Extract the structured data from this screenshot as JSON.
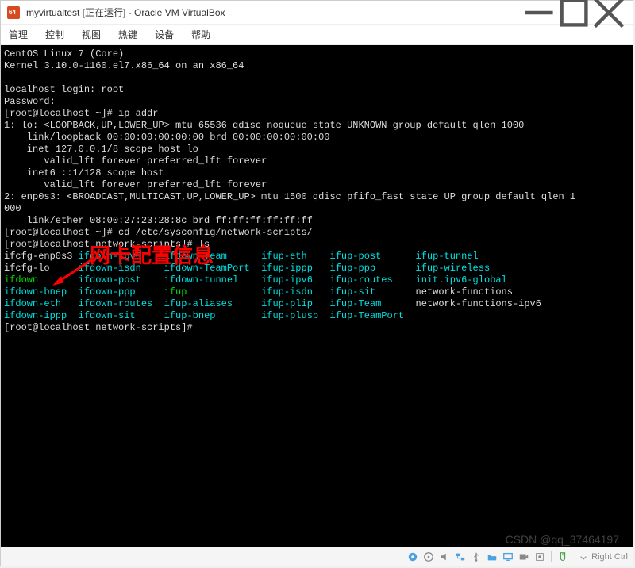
{
  "window": {
    "title": "myvirtualtest [正在运行] - Oracle VM VirtualBox"
  },
  "menu": {
    "items": [
      "管理",
      "控制",
      "视图",
      "热键",
      "设备",
      "帮助"
    ]
  },
  "terminal": {
    "lines": {
      "l1": "CentOS Linux 7 (Core)",
      "l2": "Kernel 3.10.0-1160.el7.x86_64 on an x86_64",
      "l3": "",
      "l4a": "localhost login: ",
      "l4b": "root",
      "l5": "Password:",
      "l6": "[root@localhost ~]# ip addr",
      "l7": "1: lo: <LOOPBACK,UP,LOWER_UP> mtu 65536 qdisc noqueue state UNKNOWN group default qlen 1000",
      "l8": "    link/loopback 00:00:00:00:00:00 brd 00:00:00:00:00:00",
      "l9": "    inet 127.0.0.1/8 scope host lo",
      "l10": "       valid_lft forever preferred_lft forever",
      "l11": "    inet6 ::1/128 scope host",
      "l12": "       valid_lft forever preferred_lft forever",
      "l13": "2: enp0s3: <BROADCAST,MULTICAST,UP,LOWER_UP> mtu 1500 qdisc pfifo_fast state UP group default qlen 1",
      "l14": "000",
      "l15": "    link/ether 08:00:27:23:28:8c brd ff:ff:ff:ff:ff:ff",
      "l16": "[root@localhost ~]# cd /etc/sysconfig/network-scripts/",
      "l17": "[root@localhost network-scripts]# ls",
      "r1": [
        "ifcfg-enp0s3",
        "ifdown-ipv6",
        "ifdown-Team",
        "ifup-eth",
        "ifup-post",
        "ifup-tunnel"
      ],
      "r2": [
        "ifcfg-lo",
        "ifdown-isdn",
        "ifdown-TeamPort",
        "ifup-ippp",
        "ifup-ppp",
        "ifup-wireless"
      ],
      "r3": [
        "ifdown",
        "ifdown-post",
        "ifdown-tunnel",
        "ifup-ipv6",
        "ifup-routes",
        "init.ipv6-global"
      ],
      "r4": [
        "ifdown-bnep",
        "ifdown-ppp",
        "ifup",
        "ifup-isdn",
        "ifup-sit",
        "network-functions"
      ],
      "r5": [
        "ifdown-eth",
        "ifdown-routes",
        "ifup-aliases",
        "ifup-plip",
        "ifup-Team",
        "network-functions-ipv6"
      ],
      "r6": [
        "ifdown-ippp",
        "ifdown-sit",
        "ifup-bnep",
        "ifup-plusb",
        "ifup-TeamPort",
        ""
      ],
      "l24": "[root@localhost network-scripts]#"
    }
  },
  "annotation": {
    "text": "网卡配置信息"
  },
  "statusbar": {
    "host_key": "Right Ctrl"
  },
  "watermark": "CSDN @qq_37464197"
}
